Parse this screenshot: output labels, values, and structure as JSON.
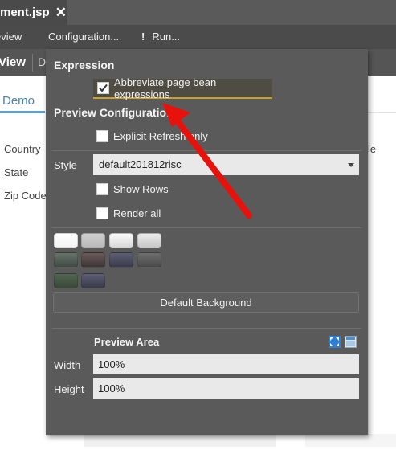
{
  "editor": {
    "file_tab_title": "ment.jsp",
    "file_tab_close": "✕",
    "toolbar": {
      "preview_label": "eview",
      "configuration_label": "Configuration...",
      "run_label": "Run..."
    },
    "view_tab": "View",
    "second_tab": "D",
    "demo_tab": "Demo",
    "fields": [
      "Country",
      "State",
      "Zip Code"
    ],
    "right_label": "le"
  },
  "panel": {
    "expression_heading": "Expression",
    "abbreviate_label": "Abbreviate page bean expressions",
    "abbreviate_checked": true,
    "preview_config_heading": "Preview Configuration",
    "explicit_refresh_label": "Explicit Refresh only",
    "explicit_refresh_checked": false,
    "style_label": "Style",
    "style_value": "default201812risc",
    "show_rows_label": "Show Rows",
    "show_rows_checked": false,
    "render_all_label": "Render all",
    "render_all_checked": false,
    "swatches": [
      {
        "name": "white",
        "color": "#ffffff"
      },
      {
        "name": "light-gray",
        "color": "#c4c4c4"
      },
      {
        "name": "white-gradient",
        "color": "#eeeeee"
      },
      {
        "name": "light-gray-gradient",
        "color": "#dadada"
      },
      {
        "name": "dark-green-gray",
        "color": "#4f5a50"
      },
      {
        "name": "dark-brown",
        "color": "#55484a"
      },
      {
        "name": "dark-slate",
        "color": "#4a4a5a"
      },
      {
        "name": "dark-gray",
        "color": "#5f5f5f"
      },
      {
        "name": "dark-green",
        "color": "#465645"
      },
      {
        "name": "dark-navy",
        "color": "#4a4a5a"
      }
    ],
    "default_background_label": "Default Background",
    "preview_area_heading": "Preview Area",
    "width_label": "Width",
    "width_value": "100%",
    "height_label": "Height",
    "height_value": "100%",
    "icons": [
      "fullscreen-icon",
      "window-icon"
    ]
  },
  "annotation": {
    "arrow_color": "#e8120c"
  }
}
